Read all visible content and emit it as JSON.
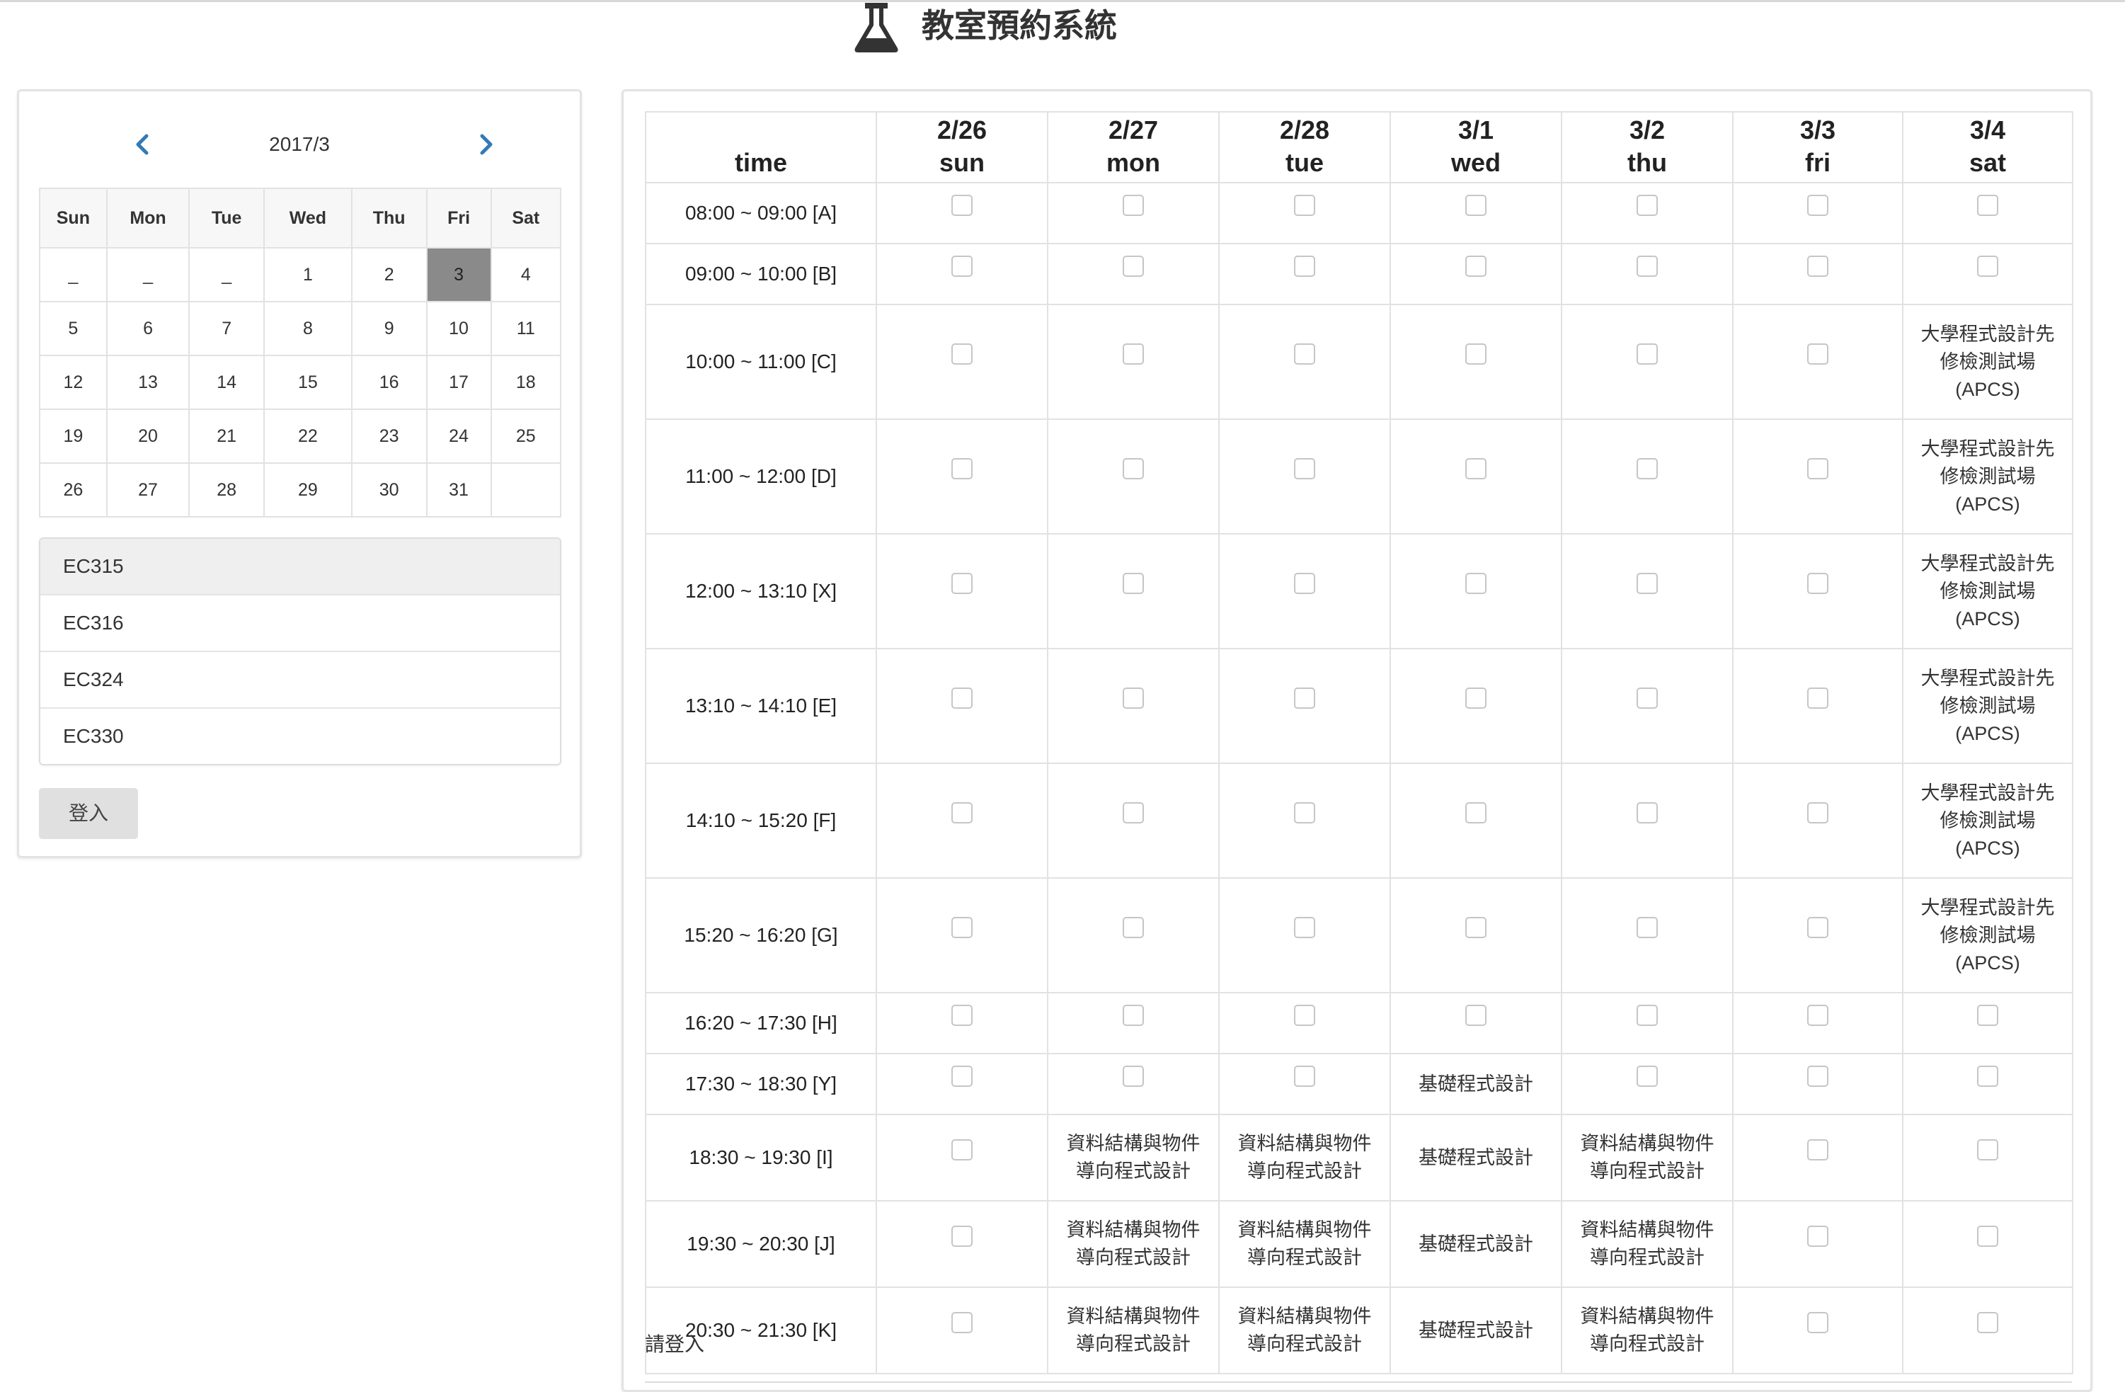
{
  "header": {
    "title": "教室預約系統",
    "logo_icon": "flask-icon"
  },
  "calendar": {
    "month_label": "2017/3",
    "prev_icon": "chevron-left-icon",
    "next_icon": "chevron-right-icon",
    "accent_color": "#337ab7",
    "weekdays": [
      "Sun",
      "Mon",
      "Tue",
      "Wed",
      "Thu",
      "Fri",
      "Sat"
    ],
    "weeks": [
      [
        "_",
        "_",
        "_",
        "1",
        "2",
        "3",
        "4"
      ],
      [
        "5",
        "6",
        "7",
        "8",
        "9",
        "10",
        "11"
      ],
      [
        "12",
        "13",
        "14",
        "15",
        "16",
        "17",
        "18"
      ],
      [
        "19",
        "20",
        "21",
        "22",
        "23",
        "24",
        "25"
      ],
      [
        "26",
        "27",
        "28",
        "29",
        "30",
        "31",
        ""
      ]
    ],
    "selected_day": "3",
    "selected_color": "#8a8a8a"
  },
  "rooms": [
    "EC315",
    "EC316",
    "EC324",
    "EC330"
  ],
  "active_room": "EC315",
  "login_label": "登入",
  "schedule": {
    "time_header": "time",
    "columns": [
      {
        "date": "2/26",
        "day": "sun"
      },
      {
        "date": "2/27",
        "day": "mon"
      },
      {
        "date": "2/28",
        "day": "tue"
      },
      {
        "date": "3/1",
        "day": "wed"
      },
      {
        "date": "3/2",
        "day": "thu"
      },
      {
        "date": "3/3",
        "day": "fri"
      },
      {
        "date": "3/4",
        "day": "sat"
      }
    ],
    "rows": [
      {
        "time": "08:00 ~ 09:00 [A]",
        "cells": [
          "",
          "",
          "",
          "",
          "",
          "",
          ""
        ]
      },
      {
        "time": "09:00 ~ 10:00 [B]",
        "cells": [
          "",
          "",
          "",
          "",
          "",
          "",
          ""
        ]
      },
      {
        "time": "10:00 ~ 11:00 [C]",
        "cells": [
          "",
          "",
          "",
          "",
          "",
          "",
          "大學程式設計先\n修檢測試場\n(APCS)"
        ]
      },
      {
        "time": "11:00 ~ 12:00 [D]",
        "cells": [
          "",
          "",
          "",
          "",
          "",
          "",
          "大學程式設計先\n修檢測試場\n(APCS)"
        ]
      },
      {
        "time": "12:00 ~ 13:10 [X]",
        "cells": [
          "",
          "",
          "",
          "",
          "",
          "",
          "大學程式設計先\n修檢測試場\n(APCS)"
        ]
      },
      {
        "time": "13:10 ~ 14:10 [E]",
        "cells": [
          "",
          "",
          "",
          "",
          "",
          "",
          "大學程式設計先\n修檢測試場\n(APCS)"
        ]
      },
      {
        "time": "14:10 ~ 15:20 [F]",
        "cells": [
          "",
          "",
          "",
          "",
          "",
          "",
          "大學程式設計先\n修檢測試場\n(APCS)"
        ]
      },
      {
        "time": "15:20 ~ 16:20 [G]",
        "cells": [
          "",
          "",
          "",
          "",
          "",
          "",
          "大學程式設計先\n修檢測試場\n(APCS)"
        ]
      },
      {
        "time": "16:20 ~ 17:30 [H]",
        "cells": [
          "",
          "",
          "",
          "",
          "",
          "",
          ""
        ]
      },
      {
        "time": "17:30 ~ 18:30 [Y]",
        "cells": [
          "",
          "",
          "",
          "基礎程式設計",
          "",
          "",
          ""
        ]
      },
      {
        "time": "18:30 ~ 19:30 [I]",
        "cells": [
          "",
          "資料結構與物件\n導向程式設計",
          "資料結構與物件\n導向程式設計",
          "基礎程式設計",
          "資料結構與物件\n導向程式設計",
          "",
          ""
        ]
      },
      {
        "time": "19:30 ~ 20:30 [J]",
        "cells": [
          "",
          "資料結構與物件\n導向程式設計",
          "資料結構與物件\n導向程式設計",
          "基礎程式設計",
          "資料結構與物件\n導向程式設計",
          "",
          ""
        ]
      },
      {
        "time": "20:30 ~ 21:30 [K]",
        "cells": [
          "",
          "資料結構與物件\n導向程式設計",
          "資料結構與物件\n導向程式設計",
          "基礎程式設計",
          "資料結構與物件\n導向程式設計",
          "",
          ""
        ]
      }
    ]
  },
  "footer_prompt": "請登入"
}
